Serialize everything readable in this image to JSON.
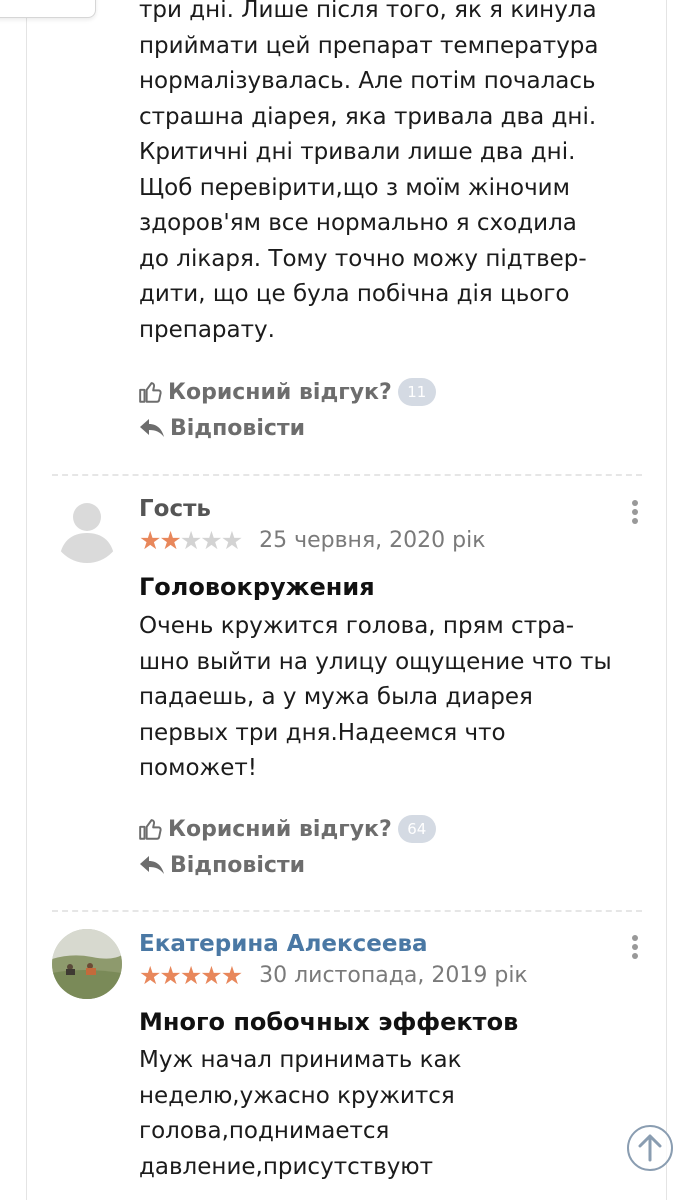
{
  "previous_review": {
    "text_lines": [
      "три дні. Лише після того, як я кинула",
      "приймати цей препарат температура",
      "нормалізувалась. Але потім почалась",
      "страшна діарея, яка тривала два дні.",
      "Критичні дні тривали лише два дні.",
      "Щоб перевірити,що з моїм жіночим",
      "здоров'ям все нормально я сходила",
      "до лікаря. Тому точно можу підтвер-",
      "дити, що це була побічна дія цього",
      "препарату."
    ],
    "helpful_label": "Корисний відгук?",
    "helpful_count": "11",
    "reply_label": "Відповісти"
  },
  "reviews": [
    {
      "author": "Гость",
      "avatar": "guest-avatar-icon",
      "rating": 2,
      "date": "25 червня, 2020 рік",
      "title": "Головокружения",
      "text_lines": [
        "Очень кружится голова, прям стра-",
        "шно выйти на улицу ощущение что ты",
        "падаешь, а у мужа была диарея",
        "первых три дня.Надеемся что",
        "поможет!"
      ],
      "helpful_label": "Корисний відгук?",
      "helpful_count": "64",
      "reply_label": "Відповісти"
    },
    {
      "author": "Екатерина Алексеева",
      "avatar": "photo-avatar",
      "rating": 5,
      "date": "30 листопада, 2019 рік",
      "title": "Много побочных эффектов",
      "text_lines": [
        "Муж начал принимать как",
        "неделю,ужасно кружится",
        "голова,поднимается",
        "давление,присутствуют"
      ]
    }
  ],
  "colors": {
    "star_on": "#e8875b",
    "star_off": "#d3d3d3",
    "author_link": "#4a78a4",
    "badge": "#d4dae3"
  },
  "icons": [
    "thumbs-up-icon",
    "reply-arrow-icon",
    "more-vert-icon",
    "scroll-top-icon"
  ]
}
